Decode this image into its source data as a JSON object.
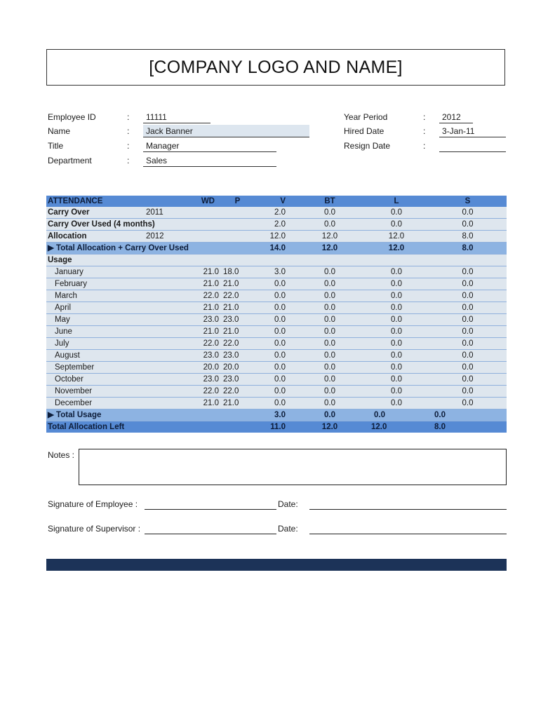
{
  "header": {
    "title": "[COMPANY LOGO AND NAME]"
  },
  "employee": {
    "left": [
      {
        "label": "Employee ID",
        "colon": ":",
        "value": "11111"
      },
      {
        "label": "Name",
        "colon": ":",
        "value": "Jack Banner"
      },
      {
        "label": "Title",
        "colon": ":",
        "value": "Manager"
      },
      {
        "label": "Department",
        "colon": ":",
        "value": "Sales"
      }
    ],
    "right": [
      {
        "label": "Year Period",
        "colon": ":",
        "value": "2012"
      },
      {
        "label": "Hired Date",
        "colon": ":",
        "value": "3-Jan-11"
      },
      {
        "label": "Resign Date",
        "colon": ":",
        "value": ""
      }
    ]
  },
  "attendance": {
    "headers": {
      "title": "ATTENDANCE",
      "wd": "WD",
      "p": "P",
      "v": "V",
      "bt": "BT",
      "l": "L",
      "s": "S"
    },
    "summary": [
      {
        "label": "Carry Over",
        "year": "2011",
        "v": "2.0",
        "bt": "0.0",
        "l": "0.0",
        "s": "0.0"
      },
      {
        "label": "Carry Over Used (4 months)",
        "year": "",
        "v": "2.0",
        "bt": "0.0",
        "l": "0.0",
        "s": "0.0"
      },
      {
        "label": "Allocation",
        "year": "2012",
        "v": "12.0",
        "bt": "12.0",
        "l": "12.0",
        "s": "8.0"
      }
    ],
    "total_allocation": {
      "label": "▶ Total Allocation + Carry Over Used",
      "v": "14.0",
      "bt": "12.0",
      "l": "12.0",
      "s": "8.0"
    },
    "usage_label": "Usage",
    "months": [
      {
        "month": "January",
        "wd": "21.0",
        "p": "18.0",
        "v": "3.0",
        "bt": "0.0",
        "l": "0.0",
        "s": "0.0"
      },
      {
        "month": "February",
        "wd": "21.0",
        "p": "21.0",
        "v": "0.0",
        "bt": "0.0",
        "l": "0.0",
        "s": "0.0"
      },
      {
        "month": "March",
        "wd": "22.0",
        "p": "22.0",
        "v": "0.0",
        "bt": "0.0",
        "l": "0.0",
        "s": "0.0"
      },
      {
        "month": "April",
        "wd": "21.0",
        "p": "21.0",
        "v": "0.0",
        "bt": "0.0",
        "l": "0.0",
        "s": "0.0"
      },
      {
        "month": "May",
        "wd": "23.0",
        "p": "23.0",
        "v": "0.0",
        "bt": "0.0",
        "l": "0.0",
        "s": "0.0"
      },
      {
        "month": "June",
        "wd": "21.0",
        "p": "21.0",
        "v": "0.0",
        "bt": "0.0",
        "l": "0.0",
        "s": "0.0"
      },
      {
        "month": "July",
        "wd": "22.0",
        "p": "22.0",
        "v": "0.0",
        "bt": "0.0",
        "l": "0.0",
        "s": "0.0"
      },
      {
        "month": "August",
        "wd": "23.0",
        "p": "23.0",
        "v": "0.0",
        "bt": "0.0",
        "l": "0.0",
        "s": "0.0"
      },
      {
        "month": "September",
        "wd": "20.0",
        "p": "20.0",
        "v": "0.0",
        "bt": "0.0",
        "l": "0.0",
        "s": "0.0"
      },
      {
        "month": "October",
        "wd": "23.0",
        "p": "23.0",
        "v": "0.0",
        "bt": "0.0",
        "l": "0.0",
        "s": "0.0"
      },
      {
        "month": "November",
        "wd": "22.0",
        "p": "22.0",
        "v": "0.0",
        "bt": "0.0",
        "l": "0.0",
        "s": "0.0"
      },
      {
        "month": "December",
        "wd": "21.0",
        "p": "21.0",
        "v": "0.0",
        "bt": "0.0",
        "l": "0.0",
        "s": "0.0"
      }
    ],
    "total_usage": {
      "label": "▶ Total Usage",
      "v": "3.0",
      "bt": "0.0",
      "l": "0.0",
      "s": "0.0"
    },
    "allocation_left": {
      "label": "Total Allocation Left",
      "v": "11.0",
      "bt": "12.0",
      "l": "12.0",
      "s": "8.0"
    }
  },
  "notes": {
    "label": "Notes :",
    "value": ""
  },
  "signatures": {
    "employee_label": "Signature of Employee :",
    "supervisor_label": "Signature of Supervisor :",
    "date_label": "Date:"
  },
  "colors": {
    "header_blue": "#568ad4",
    "total_blue": "#8db3e2",
    "row_fill": "#dee6ee",
    "footer_navy": "#1c3358"
  }
}
